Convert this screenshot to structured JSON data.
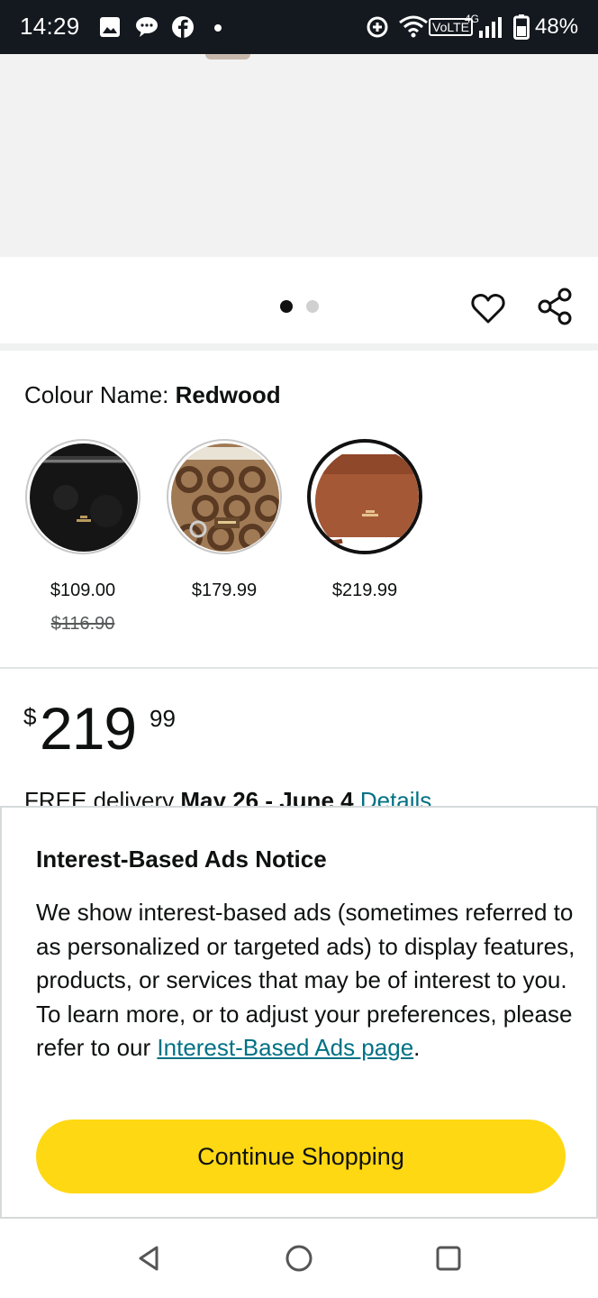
{
  "status_bar": {
    "time": "14:29",
    "network_label": "VoLTE",
    "network_gen": "4G",
    "battery": "48%",
    "icons": [
      "gallery-icon",
      "chat-bubble-icon",
      "facebook-icon",
      "dot-icon",
      "data-saver-icon",
      "wifi-icon",
      "signal-icon",
      "battery-icon"
    ]
  },
  "product": {
    "image_dots": {
      "count": 2,
      "active_index": 0
    },
    "colour_prefix": "Colour Name: ",
    "colour_name": "Redwood",
    "swatches": [
      {
        "name": "black",
        "price": "$109.00",
        "list_price": "$116.90",
        "selected": false
      },
      {
        "name": "signature-khaki",
        "price": "$179.99",
        "list_price": "",
        "selected": true
      },
      {
        "name": "redwood",
        "price": "$219.99",
        "list_price": "",
        "selected": true
      }
    ],
    "price": {
      "symbol": "$",
      "whole": "219",
      "fraction": "99"
    },
    "delivery": {
      "prefix": "FREE delivery ",
      "dates": "May 26 - June 4",
      "link": "Details"
    }
  },
  "modal": {
    "title": "Interest-Based Ads Notice",
    "body": "We show interest-based ads (sometimes referred to as personalized or targeted ads) to display features, products, or services that may be of interest to you. To learn more, or to adjust your preferences, please refer to our ",
    "link": "Interest-Based Ads page",
    "body_end": ".",
    "button": "Continue Shopping"
  },
  "colors": {
    "status_bar_bg": "#14191f",
    "button_yellow": "#ffd814",
    "link_teal": "#007185"
  }
}
